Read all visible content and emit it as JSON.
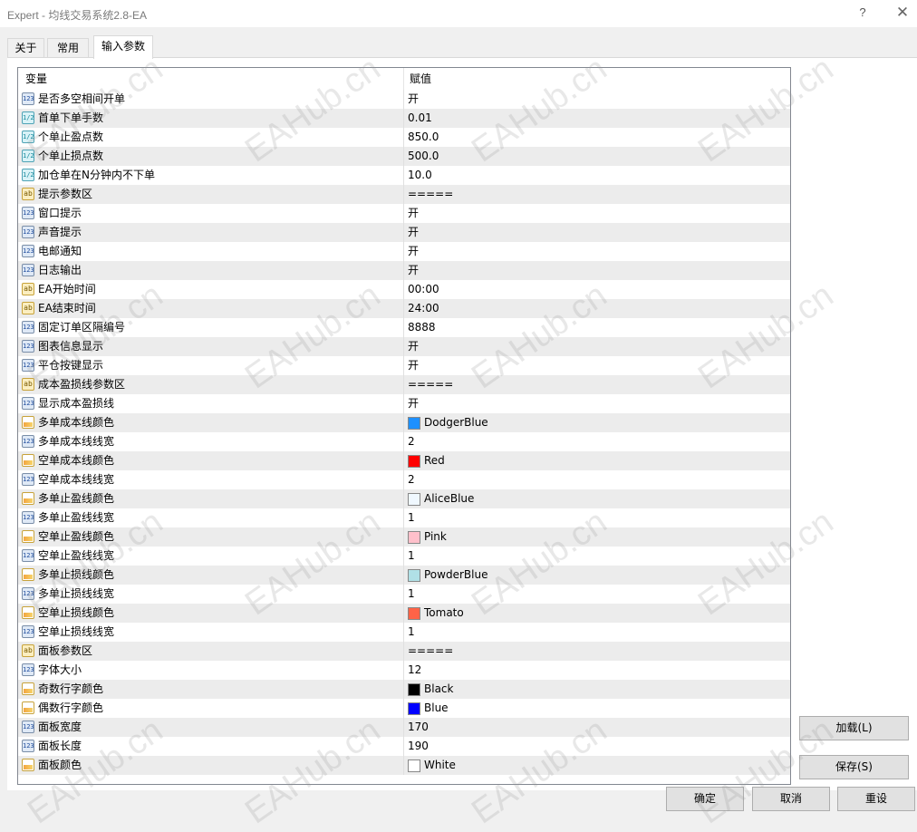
{
  "window": {
    "title": "Expert - 均线交易系统2.8-EA",
    "help": "?",
    "close": "✕"
  },
  "tabs": [
    {
      "label": "关于"
    },
    {
      "label": "常用"
    },
    {
      "label": "输入参数"
    }
  ],
  "grid": {
    "header_variable": "变量",
    "header_value": "赋值",
    "rows": [
      {
        "icon": "int",
        "icon_text": "123",
        "name": "是否多空相间开单",
        "value": "开"
      },
      {
        "icon": "dbl",
        "icon_text": "1/2",
        "name": "首单下单手数",
        "value": "0.01"
      },
      {
        "icon": "dbl",
        "icon_text": "1/2",
        "name": "个单止盈点数",
        "value": "850.0"
      },
      {
        "icon": "dbl",
        "icon_text": "1/2",
        "name": "个单止损点数",
        "value": "500.0"
      },
      {
        "icon": "dbl",
        "icon_text": "1/2",
        "name": "加仓单在N分钟内不下单",
        "value": "10.0"
      },
      {
        "icon": "str",
        "icon_text": "ab",
        "name": "提示参数区",
        "value": "====="
      },
      {
        "icon": "int",
        "icon_text": "123",
        "name": "窗口提示",
        "value": "开"
      },
      {
        "icon": "int",
        "icon_text": "123",
        "name": "声音提示",
        "value": "开"
      },
      {
        "icon": "int",
        "icon_text": "123",
        "name": "电邮通知",
        "value": "开"
      },
      {
        "icon": "int",
        "icon_text": "123",
        "name": "日志输出",
        "value": "开"
      },
      {
        "icon": "str",
        "icon_text": "ab",
        "name": "EA开始时间",
        "value": "00:00"
      },
      {
        "icon": "str",
        "icon_text": "ab",
        "name": "EA结束时间",
        "value": "24:00"
      },
      {
        "icon": "int",
        "icon_text": "123",
        "name": "固定订单区隔编号",
        "value": "8888"
      },
      {
        "icon": "int",
        "icon_text": "123",
        "name": "图表信息显示",
        "value": "开"
      },
      {
        "icon": "int",
        "icon_text": "123",
        "name": "平仓按键显示",
        "value": "开"
      },
      {
        "icon": "str",
        "icon_text": "ab",
        "name": "成本盈损线参数区",
        "value": "====="
      },
      {
        "icon": "int",
        "icon_text": "123",
        "name": "显示成本盈损线",
        "value": "开"
      },
      {
        "icon": "col",
        "icon_text": "",
        "name": "多单成本线颜色",
        "value": "DodgerBlue",
        "swatch": "#1e90ff"
      },
      {
        "icon": "int",
        "icon_text": "123",
        "name": "多单成本线线宽",
        "value": "2"
      },
      {
        "icon": "col",
        "icon_text": "",
        "name": "空单成本线颜色",
        "value": "Red",
        "swatch": "#ff0000"
      },
      {
        "icon": "int",
        "icon_text": "123",
        "name": "空单成本线线宽",
        "value": "2"
      },
      {
        "icon": "col",
        "icon_text": "",
        "name": "多单止盈线颜色",
        "value": "AliceBlue",
        "swatch": "#f0f8ff"
      },
      {
        "icon": "int",
        "icon_text": "123",
        "name": "多单止盈线线宽",
        "value": "1"
      },
      {
        "icon": "col",
        "icon_text": "",
        "name": "空单止盈线颜色",
        "value": "Pink",
        "swatch": "#ffc0cb"
      },
      {
        "icon": "int",
        "icon_text": "123",
        "name": "空单止盈线线宽",
        "value": "1"
      },
      {
        "icon": "col",
        "icon_text": "",
        "name": "多单止损线颜色",
        "value": "PowderBlue",
        "swatch": "#b0e0e6"
      },
      {
        "icon": "int",
        "icon_text": "123",
        "name": "多单止损线线宽",
        "value": "1"
      },
      {
        "icon": "col",
        "icon_text": "",
        "name": "空单止损线颜色",
        "value": "Tomato",
        "swatch": "#ff6347"
      },
      {
        "icon": "int",
        "icon_text": "123",
        "name": "空单止损线线宽",
        "value": "1"
      },
      {
        "icon": "str",
        "icon_text": "ab",
        "name": "面板参数区",
        "value": "====="
      },
      {
        "icon": "int",
        "icon_text": "123",
        "name": "字体大小",
        "value": "12"
      },
      {
        "icon": "col",
        "icon_text": "",
        "name": "奇数行字颜色",
        "value": "Black",
        "swatch": "#000000"
      },
      {
        "icon": "col",
        "icon_text": "",
        "name": "偶数行字颜色",
        "value": "Blue",
        "swatch": "#0000ff"
      },
      {
        "icon": "int",
        "icon_text": "123",
        "name": "面板宽度",
        "value": "170"
      },
      {
        "icon": "int",
        "icon_text": "123",
        "name": "面板长度",
        "value": "190"
      },
      {
        "icon": "col",
        "icon_text": "",
        "name": "面板颜色",
        "value": "White",
        "swatch": "#ffffff"
      }
    ]
  },
  "buttons": {
    "load": "加载(L)",
    "save": "保存(S)",
    "ok": "确定",
    "cancel": "取消",
    "reset": "重设"
  },
  "watermark": "EAHub.cn"
}
